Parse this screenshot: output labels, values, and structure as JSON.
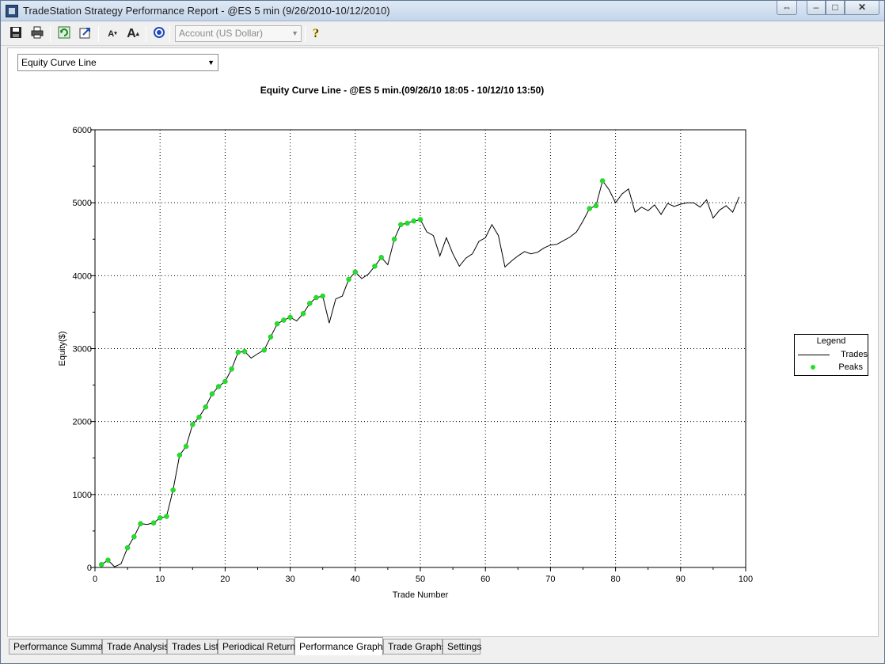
{
  "window": {
    "title": "TradeStation Strategy Performance Report - @ES 5 min (9/26/2010-10/12/2010)",
    "controls": {
      "resize": "⇔",
      "minimize": "–",
      "maximize": "□",
      "close": "✕"
    }
  },
  "toolbar": {
    "account_select_value": "Account (US Dollar)",
    "icons": [
      "save-icon",
      "print-icon",
      "refresh-icon",
      "export-icon",
      "decrease-font-icon",
      "increase-font-icon",
      "target-icon",
      "help-icon"
    ]
  },
  "graph_selector": {
    "value": "Equity Curve Line"
  },
  "chart_title": "Equity Curve Line - @ES 5 min.(09/26/10 18:05 - 10/12/10 13:50)",
  "chart_data": {
    "type": "line",
    "title": "Equity Curve Line - @ES 5 min.(09/26/10 18:05 - 10/12/10 13:50)",
    "xlabel": "Trade Number",
    "ylabel": "Equity($)",
    "xlim": [
      0,
      100
    ],
    "ylim": [
      0,
      6000
    ],
    "x_ticks": [
      0,
      10,
      20,
      30,
      40,
      50,
      60,
      70,
      80,
      90,
      100
    ],
    "y_ticks": [
      0,
      1000,
      2000,
      3000,
      4000,
      5000,
      6000
    ],
    "grid": true,
    "legend_placement": "right",
    "colors": {
      "trades": "#000000",
      "peaks": "#22e02a"
    },
    "series": [
      {
        "name": "Trades",
        "x": [
          1,
          2,
          3,
          4,
          5,
          6,
          7,
          8,
          9,
          10,
          11,
          12,
          13,
          14,
          15,
          16,
          17,
          18,
          19,
          20,
          21,
          22,
          23,
          24,
          25,
          26,
          27,
          28,
          29,
          30,
          31,
          32,
          33,
          34,
          35,
          36,
          37,
          38,
          39,
          40,
          41,
          42,
          43,
          44,
          45,
          46,
          47,
          48,
          49,
          50,
          51,
          52,
          53,
          54,
          55,
          56,
          57,
          58,
          59,
          60,
          61,
          62,
          63,
          64,
          65,
          66,
          67,
          68,
          69,
          70,
          71,
          72,
          73,
          74,
          75,
          76,
          77,
          78,
          79,
          80,
          81,
          82,
          83,
          84,
          85,
          86,
          87,
          88,
          89,
          90,
          91,
          92,
          93,
          94,
          95,
          96,
          97,
          98,
          99
        ],
        "y": [
          40,
          100,
          10,
          50,
          270,
          420,
          600,
          590,
          610,
          680,
          700,
          1060,
          1540,
          1660,
          1960,
          2060,
          2200,
          2380,
          2480,
          2550,
          2720,
          2950,
          2960,
          2870,
          2930,
          2980,
          3160,
          3340,
          3390,
          3430,
          3380,
          3480,
          3620,
          3700,
          3720,
          3350,
          3680,
          3720,
          3950,
          4050,
          3960,
          4020,
          4130,
          4250,
          4150,
          4500,
          4700,
          4720,
          4750,
          4770,
          4600,
          4550,
          4270,
          4520,
          4300,
          4130,
          4240,
          4300,
          4470,
          4520,
          4700,
          4550,
          4120,
          4200,
          4270,
          4330,
          4300,
          4320,
          4380,
          4420,
          4430,
          4480,
          4530,
          4600,
          4750,
          4920,
          4960,
          5300,
          5180,
          5000,
          5120,
          5190,
          4870,
          4940,
          4890,
          4970,
          4840,
          4990,
          4950,
          4980,
          5000,
          5000,
          4940,
          5040,
          4790,
          4900,
          4960,
          4870,
          5080
        ]
      },
      {
        "name": "Peaks",
        "x": [
          1,
          2,
          5,
          6,
          7,
          9,
          10,
          11,
          12,
          13,
          14,
          15,
          16,
          17,
          18,
          19,
          20,
          21,
          22,
          23,
          26,
          27,
          28,
          29,
          30,
          32,
          33,
          34,
          35,
          39,
          40,
          43,
          44,
          46,
          47,
          48,
          49,
          50,
          76,
          77,
          78
        ],
        "y": [
          40,
          100,
          270,
          420,
          600,
          610,
          680,
          700,
          1060,
          1540,
          1660,
          1960,
          2060,
          2200,
          2380,
          2480,
          2550,
          2720,
          2950,
          2960,
          2980,
          3160,
          3340,
          3390,
          3430,
          3480,
          3620,
          3700,
          3720,
          3950,
          4050,
          4130,
          4250,
          4500,
          4700,
          4720,
          4750,
          4770,
          4920,
          4960,
          5300
        ]
      }
    ]
  },
  "legend": {
    "title": "Legend",
    "items": [
      "Trades",
      "Peaks"
    ]
  },
  "tabs": [
    {
      "label": "Performance Summary",
      "active": false
    },
    {
      "label": "Trade Analysis",
      "active": false
    },
    {
      "label": "Trades List",
      "active": false
    },
    {
      "label": "Periodical Returns",
      "active": false
    },
    {
      "label": "Performance Graphs",
      "active": true
    },
    {
      "label": "Trade Graphs",
      "active": false
    },
    {
      "label": "Settings",
      "active": false
    }
  ]
}
